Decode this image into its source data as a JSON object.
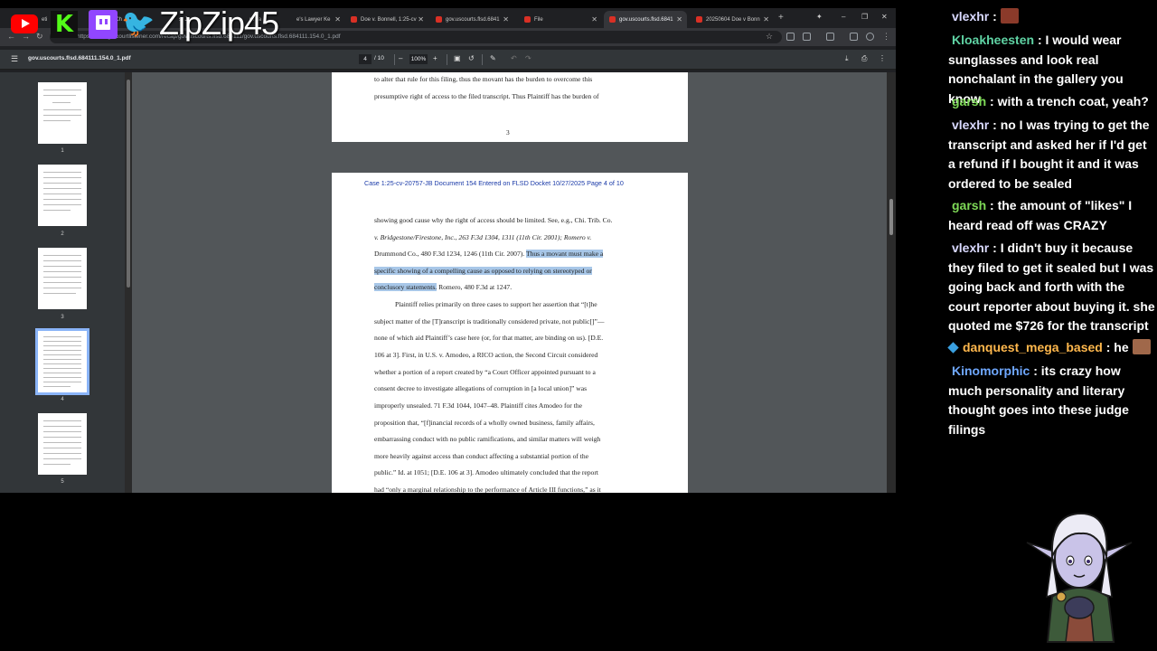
{
  "browser": {
    "tabs": [
      {
        "label": "eti"
      },
      {
        "label": "t Ch"
      },
      {
        "label": "s. Ja"
      },
      {
        "label": "nt Ja"
      },
      {
        "label": "e's Lawyer Ke"
      },
      {
        "label": "Doe v. Bonnell, 1:25-cv"
      },
      {
        "label": "gov.uscourts.flsd.6841"
      },
      {
        "label": "File"
      },
      {
        "label": "gov.uscourts.flsd.6841"
      },
      {
        "label": "20250604 Doe v Bonn"
      }
    ],
    "url": "https://storage.courtlistener.com/recap/gov.uscourts.flsd.684111/gov.uscourts.flsd.684111.154.0_1.pdf"
  },
  "pdf": {
    "filename": "gov.uscourts.flsd.684111.154.0_1.pdf",
    "page_current": "4",
    "page_total": "/ 10",
    "zoom": "100%",
    "thumb_numbers": [
      "1",
      "2",
      "3",
      "4",
      "5"
    ],
    "page3": {
      "lines": [
        "to alter that rule for this filing, thus the movant has the burden to overcome this",
        "presumptive right of access to the filed transcript.  Thus Plaintiff has the burden of"
      ],
      "page_number": "3"
    },
    "page4": {
      "header": "Case 1:25-cv-20757-JB    Document 154    Entered on FLSD Docket 10/27/2025    Page 4 of 10",
      "l1": "showing good cause why the right of access should be limited. See, e.g., Chi. Trib. Co.",
      "l2": "v. Bridgestone/Firestone, Inc., 263 F.3d 1304, 1311 (11th Cir. 2001); Romero v.",
      "l3a": "Drummond Co., 480 F.3d 1234, 1246 (11th Cir. 2007).",
      "l3b": "Thus a movant must make a",
      "l4": "specific showing of a compelling cause as opposed to relying on stereotyped or",
      "l5a": "conclusory statements.",
      "l5b": " Romero, 480 F.3d at 1247.",
      "l6": "Plaintiff relies primarily on three cases to support her assertion that “[t]he",
      "l7": "subject matter of the [T]ranscript is traditionally considered private, not public[]”—",
      "l8": "none of which aid Plaintiff’s case here (or, for that matter, are binding on us).  [D.E.",
      "l9": "106 at 3].   First, in U.S. v. Amodeo, a RICO action, the Second Circuit considered",
      "l10": "whether a portion of a report created by “a Court Officer appointed pursuant to a",
      "l11": "consent decree to investigate allegations of corruption in [a local union]” was",
      "l12": "improperly unsealed.   71 F.3d 1044, 1047–48.   Plaintiff cites Amodeo for the",
      "l13": "proposition that, “[f]inancial records of a wholly owned business, family affairs,",
      "l14": "embarrassing conduct with no public ramifications, and similar matters will weigh",
      "l15": "more heavily against access than conduct affecting a substantial portion of the",
      "l16": "public.”  Id. at 1051; [D.E. 106 at 3].  Amodeo ultimately concluded that the report",
      "l17": "had “only a marginal relationship to the performance of Article III functions,” as it"
    }
  },
  "overlay": {
    "handle": "ZipZip45",
    "kick_letter": "K",
    "bird": "🐦"
  },
  "chat": {
    "messages": [
      {
        "user": "vlexhr",
        "text": ":",
        "color": "#d9d9ff"
      },
      {
        "user": "Kloakheesten",
        "text": ": I would wear sunglasses and look real nonchalant in the gallery you know",
        "color": "#5fd3a4"
      },
      {
        "user": "garsh",
        "text": ": with a trench coat, yeah?",
        "color": "#7ed957"
      },
      {
        "user": "vlexhr",
        "text": ": no I was trying to get the transcript and asked her if I'd get a refund if I bought it and it was ordered to be sealed",
        "color": "#d9d9ff"
      },
      {
        "user": "garsh",
        "text": ": the amount of \"likes\" I heard read off was CRAZY",
        "color": "#7ed957"
      },
      {
        "user": "vlexhr",
        "text": ": I didn't buy it because they filed to get it sealed but I was going back and forth with the court reporter about buying it. she quoted me $726 for the transcript",
        "color": "#d9d9ff"
      },
      {
        "user": "danquest_mega_based",
        "text": ": he",
        "color": "#ffb84d"
      },
      {
        "user": "Kinomorphic",
        "text": ": its crazy how much personality and literary thought goes into these judge filings",
        "color": "#6fa8ff"
      }
    ]
  }
}
